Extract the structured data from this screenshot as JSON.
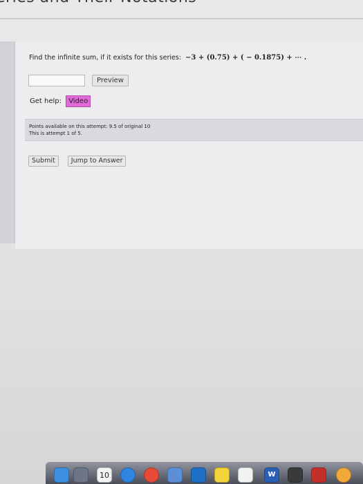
{
  "page": {
    "heading": "eries and Their Notations"
  },
  "question": {
    "prompt": "Find the infinite sum, if it exists for this series:",
    "series": "−3 + (0.75) + ( − 0.1875) + ⋯ ."
  },
  "answer": {
    "value": "",
    "placeholder": ""
  },
  "buttons": {
    "preview": "Preview",
    "submit": "Submit",
    "jump_to_answer": "Jump to Answer"
  },
  "help": {
    "label": "Get help:",
    "video": "Video"
  },
  "attempt": {
    "points": "Points available on this attempt: 9.5 of original 10",
    "attempt_text": "This is attempt 1 of 5."
  },
  "dock": {
    "calendar_day": "10",
    "word_label": "W",
    "icons": [
      "finder-icon",
      "launchpad-icon",
      "calendar-icon",
      "safari-icon",
      "chrome-icon",
      "preview-icon",
      "outlook-icon",
      "notes-icon",
      "reminders-icon",
      "word-icon",
      "app-icon",
      "photo-booth-icon",
      "photos-icon"
    ],
    "colors": {
      "finder": "#3d8fe0",
      "launchpad": "#6c7686",
      "calendar": "#f4f4f4",
      "safari": "#2f86e0",
      "chrome": "#e94a35",
      "preview": "#5c8fd6",
      "outlook": "#1f6fc5",
      "notes": "#f3d23a",
      "reminders": "#f2f2f2",
      "word": "#2b5fb4",
      "app": "#3a3a3a",
      "photo-booth": "#c3302c",
      "photos": "#f1a93a"
    }
  }
}
